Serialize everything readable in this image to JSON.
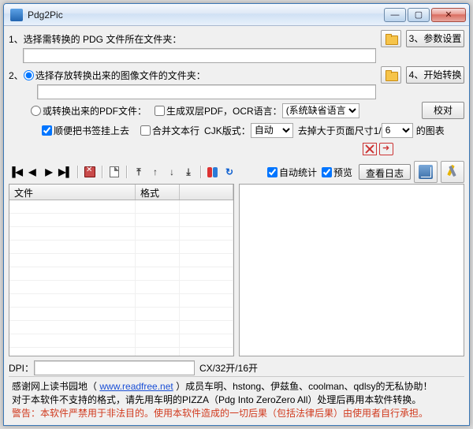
{
  "title": "Pdg2Pic",
  "step1_label": "1、选择需转换的 PDG 文件所在文件夹：",
  "step1_value": "",
  "btn3": "3、参数设置",
  "step2_label": "2、",
  "step2_radio": "选择存放转换出来的图像文件的文件夹：",
  "step2_value": "",
  "btn4": "4、开始转换",
  "pdf_radio": "或转换出来的PDF文件：",
  "gen_ocr_chk": "生成双层PDF，OCR语言：",
  "ocr_lang_sel": "(系统缺省语言)",
  "check_btn": "校对",
  "bookmark_chk": "顺便把书签挂上去",
  "merge_chk": "合并文本行",
  "cjk_label": "CJK版式：",
  "cjk_sel": "自动",
  "trim_label": "去掉大于页面尺寸1/",
  "trim_sel": "6",
  "trim_tail": "的图表",
  "auto_stat": "自动统计",
  "preview": "预览",
  "view_log": "查看日志",
  "cols": {
    "file": "文件",
    "format": "格式",
    "blank": ""
  },
  "rows_count": 14,
  "dpi_label": "DPI：",
  "dpi_value": "",
  "dpi_tail": "CX/32开/16开",
  "footer": {
    "l1a": "感谢网上读书园地（",
    "link": "www.readfree.net",
    "l1b": "）成员车明、hstong、伊兹鱼、coolman、qdlsy的无私协助！",
    "l2": "对于本软件不支持的格式，请先用车明的PIZZA（Pdg Into ZeroZero All）处理后再用本软件转换。",
    "l3": "警告：本软件严禁用于非法目的。使用本软件造成的一切后果（包括法律后果）由使用者自行承担。"
  }
}
